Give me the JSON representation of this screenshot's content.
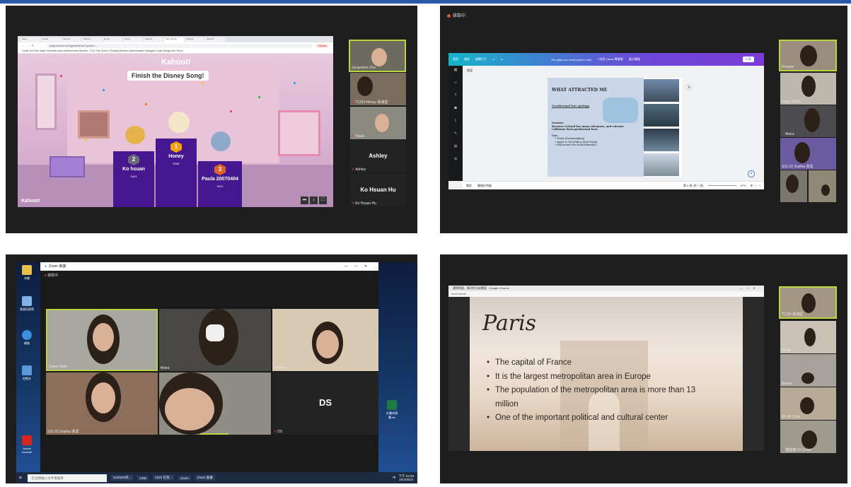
{
  "q1": {
    "browser": {
      "tabs": [
        "Inbox",
        "Gmail",
        "Kahoot!",
        "Kahoot!",
        "Home",
        "Home",
        "Kahoot!",
        "Play Kahoot",
        "Kahoot!",
        "Kahoot!"
      ],
      "url": "play.kahoot.it/v2/gameblock?quizId=...",
      "update_label": "Update",
      "bookmarks": "Gmail  YouTube  Maps  Translate  www.niceflowhome  Member - ECE  The Guide of Editing  Member Authentication  Navigator Login  Design and Techn..."
    },
    "kahoot": {
      "logo": "Kahoot!",
      "title": "Finish the Disney Song!",
      "footer_logo": "Kahoot!",
      "podium": [
        {
          "rank": "2",
          "name": "Ko hsuan",
          "score": "3441"
        },
        {
          "rank": "1",
          "name": "Honey",
          "score": "5336"
        },
        {
          "rank": "3",
          "name": "Paula 20070404",
          "score": "2612"
        }
      ]
    },
    "participants": [
      {
        "name": "Jacqueline Zhu"
      },
      {
        "name": "TCSH-Honey 黃湘瑩"
      },
      {
        "name": "Paula"
      },
      {
        "name": "Ashley",
        "display": "Ashley"
      },
      {
        "name": "Ko Hsuan Hu",
        "display": "Ko Hsuan Hu"
      }
    ]
  },
  "q2": {
    "share_label": "錄製中",
    "canva": {
      "top_items": [
        "首頁",
        "檔案",
        "調整尺寸",
        "The place you most want to visit",
        "+ 試用 Canva 專業版",
        "展示簡報",
        "分享"
      ],
      "page_label": "頁面",
      "slide_title": "WHAT ATTRACTED ME",
      "slide_subtitle": "Geothermal hot springs",
      "slide_body": [
        "Genesis:",
        "Because Iceland has many volcanoes, and volcanic collisions form geothermal heat.",
        "Use:",
        "Drink it(winemaking)",
        "Apply to face(Silica Mud Mask)",
        "Rejuvenate the body(Minerals)"
      ],
      "bottom_left": [
        "備註",
        "簡報計時器"
      ],
      "page_counter": "第 6 頁 (共 7 頁)",
      "zoom": "57%"
    },
    "participants": [
      {
        "name": "Phoebe"
      },
      {
        "name": "Diane Sabo"
      },
      {
        "name": "Moira"
      },
      {
        "name": "S31-30 Sophia 黃善"
      },
      {
        "name": ""
      },
      {
        "name": ""
      }
    ]
  },
  "q3": {
    "zoom_title": "Zoom 會議",
    "recording": "錄製中",
    "desktop_icons": [
      "本機",
      "資源回收筒",
      "網路",
      "控制台",
      "Adobe Acrobat"
    ],
    "desktop_file": "計畫申請書.xls",
    "gallery": [
      {
        "name": "Diane Sabo"
      },
      {
        "name": "Moira"
      },
      {
        "name": "Phoebe"
      },
      {
        "name": "S31-32 Sophia 黃善"
      },
      {
        "name": ""
      },
      {
        "name": "DS",
        "display": "DS"
      }
    ],
    "taskbar": {
      "search_placeholder": "在這裡輸入文字來搜尋",
      "apps": [
        "1120525英...",
        "LINE",
        "2023 在英...",
        "Zoom",
        "Zoom 會議"
      ],
      "time": "下午 03:28",
      "date": "2023/5/24",
      "ime": "中"
    }
  },
  "q4": {
    "window_title": "選擇視窗，應用程式或畫面 - Google Chrome",
    "subbar": "docs.kitfunk",
    "slide": {
      "title": "Paris",
      "bullets": [
        "The capital of France",
        "It is the largest metropolitan area in Europe",
        "The population of the metropolitan area is more than 13 million",
        "One of the important political and cultural center"
      ]
    },
    "participants": [
      {
        "name": "TCSH 黃湘瑩"
      },
      {
        "name": "Sintia"
      },
      {
        "name": "Bonnie"
      },
      {
        "name": "S0-45 Chris"
      },
      {
        "name": "施庭蓁 24 Grace"
      }
    ]
  },
  "colors": {
    "active_border": "#b9d63e",
    "kahoot_purple": "#46178f",
    "canva_gradient_start": "#16b5c9",
    "canva_gradient_end": "#7b3bd6",
    "zoom_bg": "#1e1e1e"
  }
}
